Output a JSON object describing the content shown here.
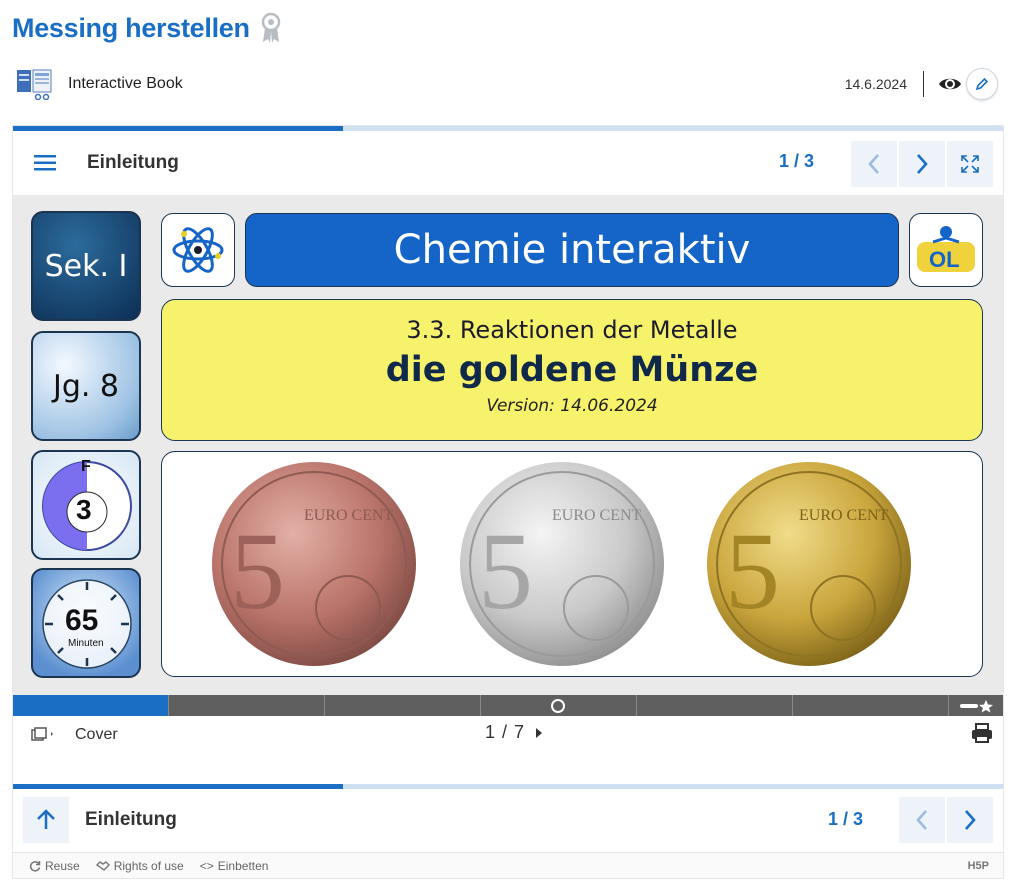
{
  "page": {
    "title": "Messing herstellen",
    "content_type": "Interactive Book",
    "date": "14.6.2024"
  },
  "book": {
    "chapter_title": "Einleitung",
    "chapter_counter": "1 / 3",
    "chapter_progress": 0.333,
    "slide": {
      "tiles": [
        "Sek. I",
        "Jg. 8",
        "F",
        "3",
        "65",
        "Minuten"
      ],
      "banner_title": "Chemie interaktiv",
      "logo_text": "OL",
      "subtitle_line1": "3.3. Reaktionen der Metalle",
      "subtitle_line2": "die goldene Münze",
      "version": "Version: 14.06.2024",
      "coins": [
        {
          "label": "5",
          "text": "EURO CENT",
          "color": "#b9736a"
        },
        {
          "label": "5",
          "text": "EURO CENT",
          "color": "#c9c9c9"
        },
        {
          "label": "5",
          "text": "EURO CENT",
          "color": "#c9a53c"
        }
      ]
    },
    "slide_progress": 0.143,
    "cover_label": "Cover",
    "page_ratio": "1 / 7",
    "bottom_chapter_title": "Einleitung",
    "bottom_chapter_counter": "1 / 3"
  },
  "footer": {
    "reuse": "Reuse",
    "rights": "Rights of use",
    "embed": "Einbetten",
    "logo": "H5P"
  },
  "colors": {
    "accent": "#1a6fc4",
    "banner": "#1565c8",
    "subtitle_bg": "#f7f26b"
  }
}
